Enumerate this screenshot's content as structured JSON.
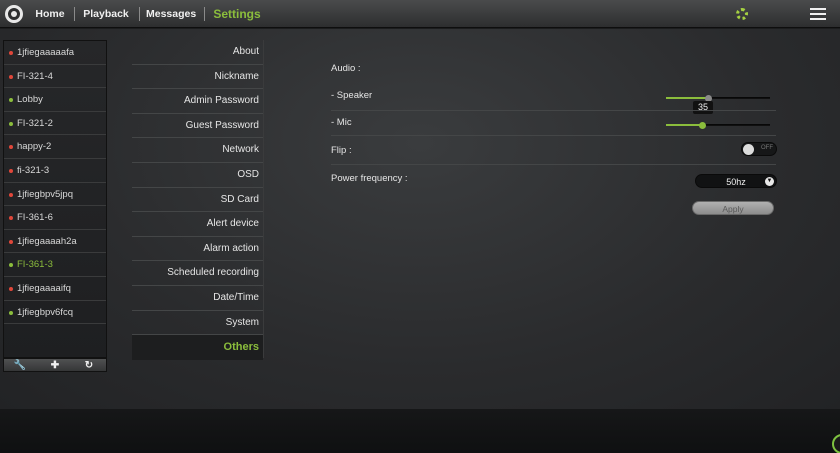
{
  "nav": {
    "items": [
      {
        "label": "Home"
      },
      {
        "label": "Playback"
      },
      {
        "label": "Messages"
      },
      {
        "label": "Settings"
      }
    ]
  },
  "devices": [
    {
      "name": "1jfiegaaaaafa",
      "status": "offline"
    },
    {
      "name": "FI-321-4",
      "status": "offline"
    },
    {
      "name": "Lobby",
      "status": "online"
    },
    {
      "name": "FI-321-2",
      "status": "online"
    },
    {
      "name": "happy-2",
      "status": "offline"
    },
    {
      "name": "fi-321-3",
      "status": "offline"
    },
    {
      "name": "1jfiegbpv5jpq",
      "status": "offline"
    },
    {
      "name": "FI-361-6",
      "status": "offline"
    },
    {
      "name": "1jfiegaaaah2a",
      "status": "offline"
    },
    {
      "name": "FI-361-3",
      "status": "online"
    },
    {
      "name": "1jfiegaaaaifq",
      "status": "offline"
    },
    {
      "name": "1jfiegbpv6fcq",
      "status": "online"
    }
  ],
  "device_tools": [
    {
      "icon": "wrench-icon",
      "glyph": "🔧"
    },
    {
      "icon": "plus-icon",
      "glyph": "✚"
    },
    {
      "icon": "refresh-icon",
      "glyph": "↻"
    }
  ],
  "settings_menu": [
    {
      "label": "About"
    },
    {
      "label": "Nickname"
    },
    {
      "label": "Admin Password"
    },
    {
      "label": "Guest Password"
    },
    {
      "label": "Network"
    },
    {
      "label": "OSD"
    },
    {
      "label": "SD Card"
    },
    {
      "label": "Alert device"
    },
    {
      "label": "Alarm action"
    },
    {
      "label": "Scheduled recording"
    },
    {
      "label": "Date/Time"
    },
    {
      "label": "System"
    },
    {
      "label": "Others"
    }
  ],
  "others": {
    "audio_label": "Audio :",
    "speaker_label": "- Speaker",
    "speaker_value": "35",
    "speaker_level": 0.4,
    "mic_label": "- Mic",
    "mic_level": 0.35,
    "flip_label": "Flip :",
    "flip_state": "OFF",
    "power_frequency_label": "Power frequency :",
    "power_frequency_value": "50hz",
    "apply_label": "Apply"
  },
  "colors": {
    "accent_green": "#8bbd3c",
    "online_dot": "#8bbd3c",
    "offline_dot": "#e0473a"
  }
}
